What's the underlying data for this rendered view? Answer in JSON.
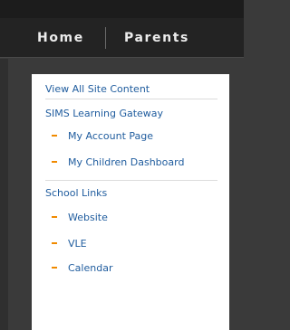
{
  "nav": {
    "items": [
      {
        "label": "Home"
      },
      {
        "label": "Parents"
      }
    ]
  },
  "sidebar": {
    "view_all": "View All Site Content",
    "sections": [
      {
        "title": "SIMS Learning Gateway",
        "items": [
          {
            "label": "My Account Page"
          },
          {
            "label": "My Children Dashboard"
          }
        ]
      },
      {
        "title": "School Links",
        "items": [
          {
            "label": "Website"
          },
          {
            "label": "VLE"
          },
          {
            "label": "Calendar"
          }
        ]
      }
    ]
  },
  "colors": {
    "link": "#1f5c9e",
    "bullet": "#f08a00",
    "navbar": "#232323",
    "background": "#3a3a3a"
  }
}
